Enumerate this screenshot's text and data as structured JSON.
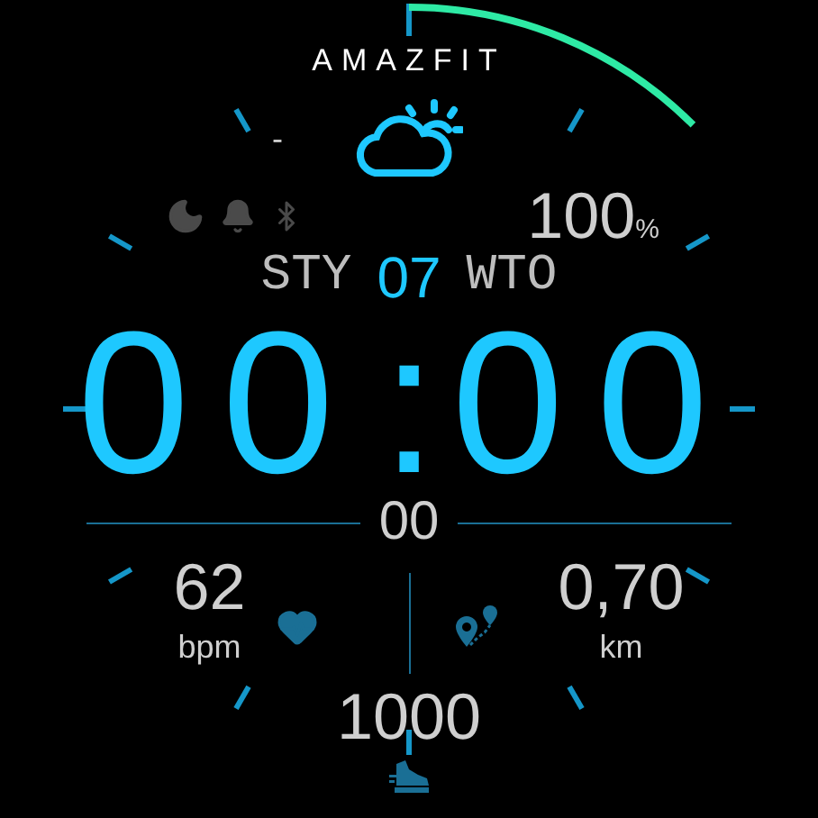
{
  "brand": "AMAZFIT",
  "weather": {
    "temperature": "-"
  },
  "battery": {
    "value": "100",
    "unit": "%"
  },
  "date": {
    "month": "STY",
    "day": "07",
    "weekday": "WTO"
  },
  "time": {
    "hours": "00",
    "separator": ":",
    "minutes": "00",
    "seconds": "00"
  },
  "heart_rate": {
    "value": "62",
    "unit": "bpm"
  },
  "distance": {
    "value": "0,70",
    "unit": "km"
  },
  "steps": {
    "value": "1000"
  }
}
